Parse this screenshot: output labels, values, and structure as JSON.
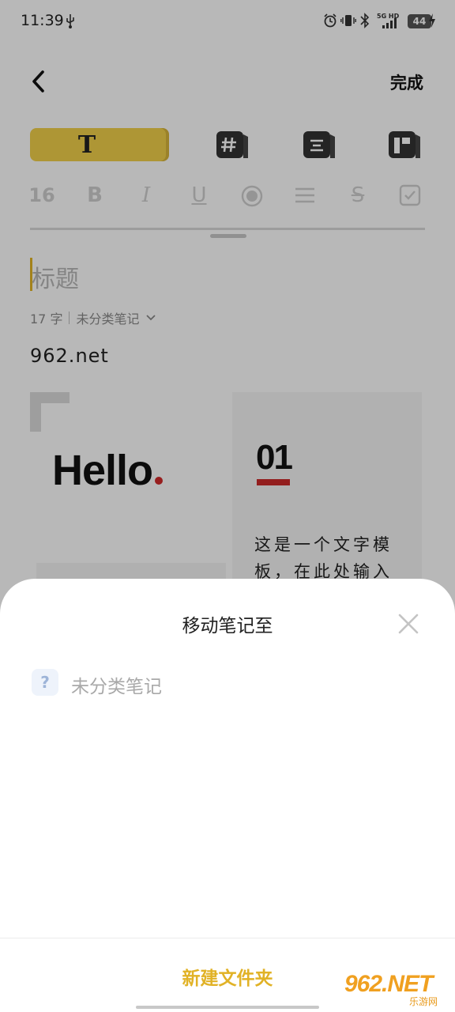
{
  "status_bar": {
    "time": "11:39",
    "battery": "44",
    "icons": [
      "usb-icon",
      "alarm-icon",
      "vibrate-icon",
      "bluetooth-icon",
      "5g-hd-icon",
      "signal-icon",
      "battery-icon",
      "charging-icon"
    ]
  },
  "header": {
    "back_icon": "chevron-left-icon",
    "done_label": "完成"
  },
  "toolbar": {
    "text_tool_label": "T",
    "tools": [
      "hashtag-card-icon",
      "text-align-card-icon",
      "layout-card-icon"
    ],
    "format": {
      "font_size": "16",
      "bold": "B",
      "italic": "I",
      "underline": "U",
      "strike": "S"
    }
  },
  "editor": {
    "title_placeholder": "标题",
    "char_count": "17 字",
    "category": "未分类笔记",
    "body": "962.net"
  },
  "template": {
    "hello_text": "Hello",
    "number": "01",
    "text_line1": "这是一个文字模",
    "text_line2": "板，在此处输入"
  },
  "sheet": {
    "title": "移动笔记至",
    "folders": [
      {
        "label": "未分类笔记",
        "icon": "?"
      }
    ],
    "new_folder_label": "新建文件夹"
  },
  "watermark": {
    "main": "962.NET",
    "sub": "乐游网"
  },
  "colors": {
    "accent": "#e1b226",
    "template_red": "#cc2a2a",
    "overlay": "rgba(0,0,0,0.28)"
  }
}
